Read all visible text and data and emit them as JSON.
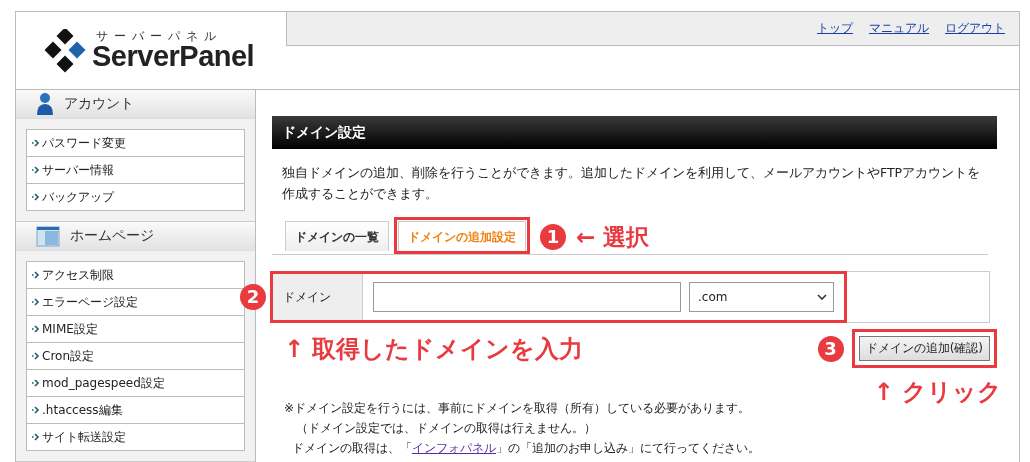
{
  "header": {
    "logo_kana": "サーバーパネル",
    "logo": "ServerPanel",
    "links": [
      "トップ",
      "マニュアル",
      "ログアウト"
    ]
  },
  "sidebar": {
    "sections": [
      {
        "title": "アカウント",
        "kind": "person",
        "items": [
          "パスワード変更",
          "サーバー情報",
          "バックアップ"
        ]
      },
      {
        "title": "ホームページ",
        "kind": "window",
        "items": [
          "アクセス制限",
          "エラーページ設定",
          "MIME設定",
          "Cron設定",
          "mod_pagespeed設定",
          ".htaccess編集",
          "サイト転送設定"
        ]
      }
    ]
  },
  "main": {
    "title": "ドメイン設定",
    "description": "独自ドメインの追加、削除を行うことができます。追加したドメインを利用して、メールアカウントやFTPアカウントを作成することができます。",
    "tabs": [
      {
        "label": "ドメインの一覧",
        "selected": false,
        "highlighted": false
      },
      {
        "label": "ドメインの追加設定",
        "selected": true,
        "highlighted": true
      }
    ],
    "tab_callout": {
      "number": "1",
      "text": "← 選択"
    },
    "form": {
      "highlighted": true,
      "number": "2",
      "label": "ドメイン",
      "select": ".com",
      "callout": "↑ 取得したドメインを入力"
    },
    "button": {
      "label": "ドメインの追加(確認)",
      "highlighted": true,
      "number": "3",
      "callout": "↑ クリック"
    },
    "notes": [
      "※ドメイン設定を行うには、事前にドメインを取得（所有）している必要があります。",
      "（ドメイン設定では、ドメインの取得は行えません。）"
    ],
    "note_link": {
      "before": "ドメインの取得は、「",
      "link": "インフォパネル",
      "after": "」の「追加のお申し込み」にて行ってください。"
    }
  }
}
